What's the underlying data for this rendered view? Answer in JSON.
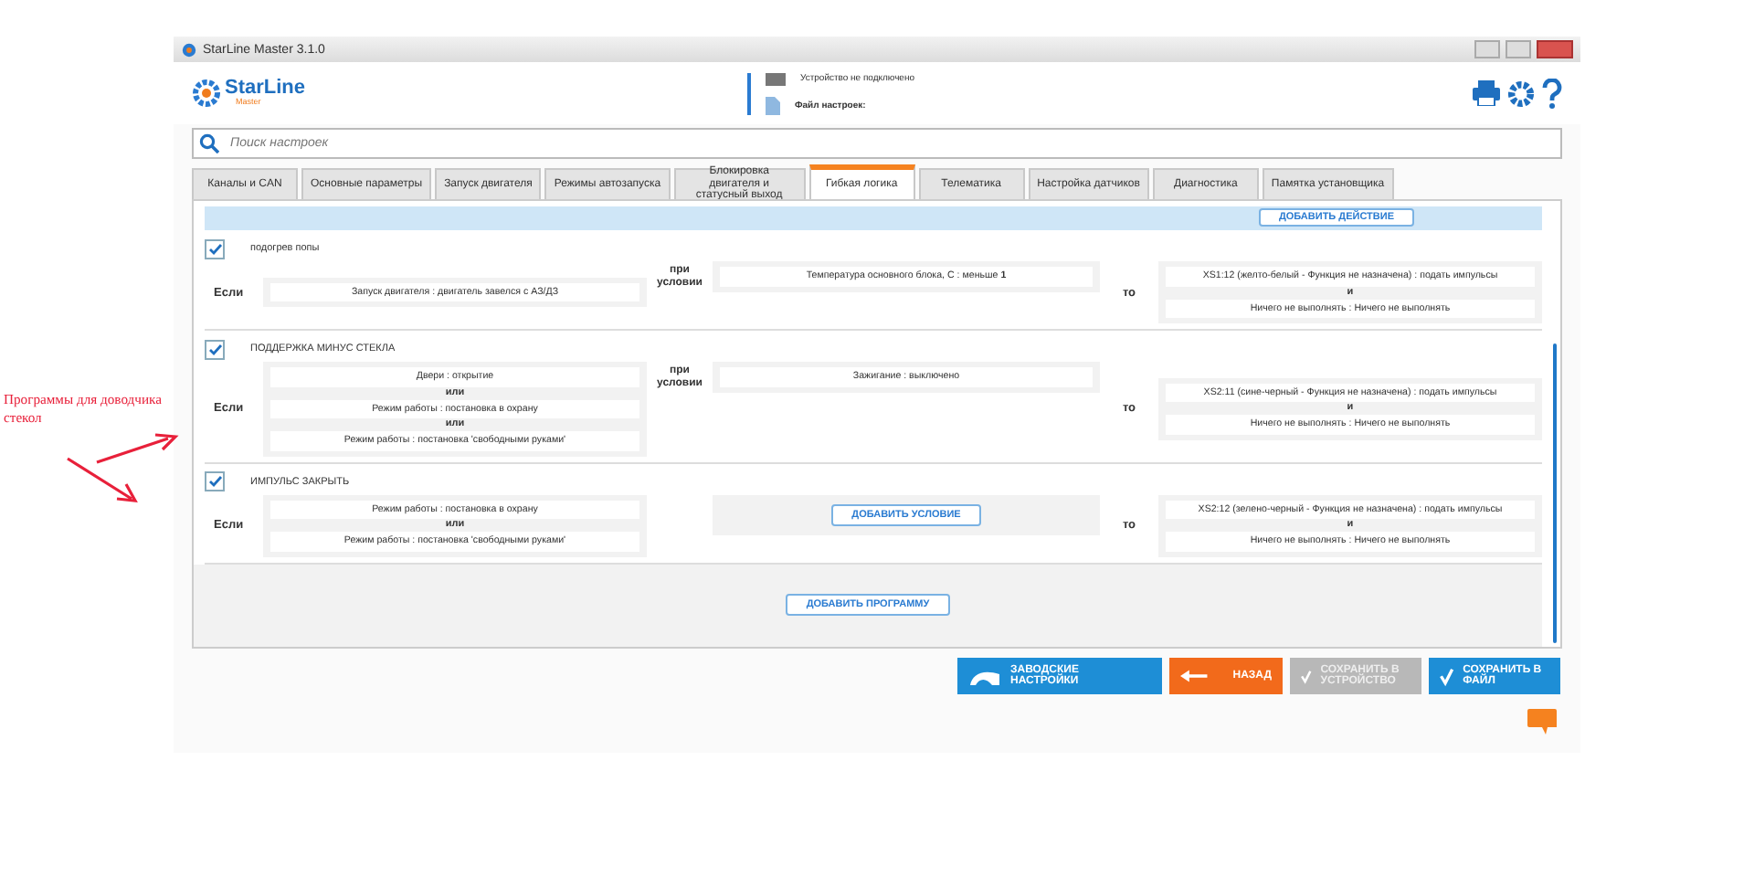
{
  "annotation": {
    "text": "Программы для доводчика стекол"
  },
  "window": {
    "title": "StarLine Master 3.1.0"
  },
  "header": {
    "logo": "StarLine",
    "logo_sub": "Master",
    "device_status": "Устройство не подключено",
    "settings_file": "Файл настроек:"
  },
  "search": {
    "placeholder": "Поиск настроек"
  },
  "tabs": [
    {
      "label": "Каналы и CAN",
      "selected": false
    },
    {
      "label": "Основные параметры",
      "selected": false
    },
    {
      "label": "Запуск двигателя",
      "selected": false
    },
    {
      "label": "Режимы автозапуска",
      "selected": false
    },
    {
      "label": "Блокировка двигателя и статусный выход",
      "selected": false
    },
    {
      "label": "Гибкая логика",
      "selected": true
    },
    {
      "label": "Телематика",
      "selected": false
    },
    {
      "label": "Настройка датчиков",
      "selected": false
    },
    {
      "label": "Диагностика",
      "selected": false
    },
    {
      "label": "Памятка установщика",
      "selected": false
    }
  ],
  "top_strip": {
    "button": "ДОБАВИТЬ ДЕЙСТВИЕ"
  },
  "programs": [
    {
      "enabled": true,
      "name": "подогрев попы",
      "if_label": "Если",
      "when_label": "при условии",
      "then_label": "то",
      "triggers": [
        {
          "text": "Запуск двигателя : двигатель завелся с АЗ/ДЗ"
        }
      ],
      "conditions": [
        {
          "text": "Температура основного блока, С : меньше **1**"
        }
      ],
      "actions": [
        {
          "text": "XS1:12 (желто-белый - Функция не назначена) : подать импульсы"
        },
        {
          "joiner": "и",
          "text": "Ничего не выполнять : Ничего не выполнять"
        }
      ]
    },
    {
      "enabled": true,
      "name": "ПОДДЕРЖКА МИНУС СТЕКЛА",
      "if_label": "Если",
      "when_label": "при условии",
      "then_label": "то",
      "triggers": [
        {
          "text": "Двери : открытие"
        },
        {
          "joiner": "или",
          "text": "Режим работы : постановка в охрану"
        },
        {
          "joiner": "или",
          "text": "Режим работы : постановка 'свободными руками'"
        }
      ],
      "conditions": [
        {
          "text": "Зажигание : выключено"
        }
      ],
      "actions": [
        {
          "text": "XS2:11 (сине-черный - Функция не назначена) : подать импульсы"
        },
        {
          "joiner": "и",
          "text": "Ничего не выполнять : Ничего не выполнять"
        }
      ]
    },
    {
      "enabled": true,
      "name": "ИМПУЛЬС ЗАКРЫТЬ",
      "if_label": "Если",
      "then_label": "то",
      "add_condition": "ДОБАВИТЬ УСЛОВИЕ",
      "triggers": [
        {
          "text": "Режим работы : постановка в охрану"
        },
        {
          "joiner": "или",
          "text": "Режим работы : постановка 'свободными руками'"
        }
      ],
      "actions": [
        {
          "text": "XS2:12 (зелено-черный - Функция не назначена) : подать импульсы"
        },
        {
          "joiner": "и",
          "text": "Ничего не выполнять : Ничего не выполнять"
        }
      ]
    }
  ],
  "add_program": "ДОБАВИТЬ ПРОГРАММУ",
  "footer_buttons": [
    {
      "kind": "factory",
      "label": "ЗАВОДСКИЕ НАСТРОЙКИ",
      "disabled": false
    },
    {
      "kind": "back",
      "label": "НАЗАД",
      "disabled": false
    },
    {
      "kind": "save",
      "label": "СОХРАНИТЬ В УСТРОЙСТВО",
      "disabled": true
    },
    {
      "kind": "save",
      "label": "СОХРАНИТЬ В ФАЙЛ",
      "disabled": false
    }
  ]
}
